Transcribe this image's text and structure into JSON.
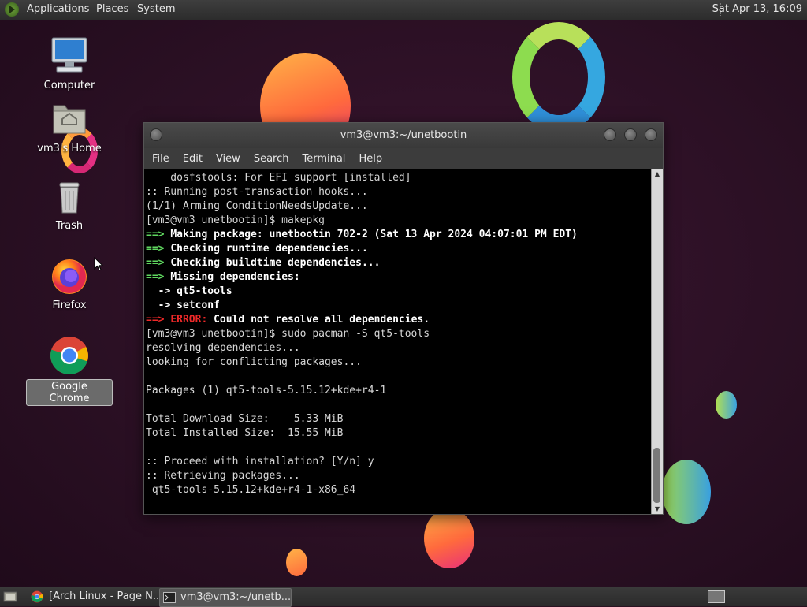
{
  "top_panel": {
    "menus": [
      "Applications",
      "Places",
      "System"
    ],
    "clock": "Sat Apr 13, 16:09"
  },
  "desktop_icons": [
    {
      "label": "Computer",
      "icon": "computer-icon"
    },
    {
      "label": "vm3's Home",
      "icon": "home-folder-icon"
    },
    {
      "label": "Trash",
      "icon": "trash-icon"
    },
    {
      "label": "Firefox",
      "icon": "firefox-icon"
    },
    {
      "label": "Google Chrome",
      "icon": "chrome-icon",
      "selected": true
    }
  ],
  "terminal": {
    "title": "vm3@vm3:~/unetbootin",
    "menu": [
      "File",
      "Edit",
      "View",
      "Search",
      "Terminal",
      "Help"
    ],
    "lines": [
      [
        {
          "t": "    dosfstools: For EFI support [installed]"
        }
      ],
      [
        {
          "t": ":: Running post-transaction hooks..."
        }
      ],
      [
        {
          "t": "(1/1) Arming ConditionNeedsUpdate..."
        }
      ],
      [
        {
          "t": "[vm3@vm3 unetbootin]$ makepkg"
        }
      ],
      [
        {
          "t": "==> ",
          "c": "g"
        },
        {
          "t": "Making package: unetbootin 702-2 (Sat 13 Apr 2024 04:07:01 PM EDT)",
          "c": "b"
        }
      ],
      [
        {
          "t": "==> ",
          "c": "g"
        },
        {
          "t": "Checking runtime dependencies...",
          "c": "b"
        }
      ],
      [
        {
          "t": "==> ",
          "c": "g"
        },
        {
          "t": "Checking buildtime dependencies...",
          "c": "b"
        }
      ],
      [
        {
          "t": "==> ",
          "c": "g"
        },
        {
          "t": "Missing dependencies:",
          "c": "b"
        }
      ],
      [
        {
          "t": "  -> ",
          "c": "b"
        },
        {
          "t": "qt5-tools",
          "c": "b"
        }
      ],
      [
        {
          "t": "  -> ",
          "c": "b"
        },
        {
          "t": "setconf",
          "c": "b"
        }
      ],
      [
        {
          "t": "==> ",
          "c": "r"
        },
        {
          "t": "ERROR: ",
          "c": "r"
        },
        {
          "t": "Could not resolve all dependencies.",
          "c": "b"
        }
      ],
      [
        {
          "t": "[vm3@vm3 unetbootin]$ sudo pacman -S qt5-tools"
        }
      ],
      [
        {
          "t": "resolving dependencies..."
        }
      ],
      [
        {
          "t": "looking for conflicting packages..."
        }
      ],
      [
        {
          "t": ""
        }
      ],
      [
        {
          "t": "Packages (1) qt5-tools-5.15.12+kde+r4-1"
        }
      ],
      [
        {
          "t": ""
        }
      ],
      [
        {
          "t": "Total Download Size:    5.33 MiB"
        }
      ],
      [
        {
          "t": "Total Installed Size:  15.55 MiB"
        }
      ],
      [
        {
          "t": ""
        }
      ],
      [
        {
          "t": ":: Proceed with installation? [Y/n] y"
        }
      ],
      [
        {
          "t": ":: Retrieving packages..."
        }
      ],
      [
        {
          "t": " qt5-tools-5.15.12+kde+r4-1-x86_64"
        }
      ]
    ]
  },
  "taskbar": {
    "tasks": [
      {
        "label": "[Arch Linux - Page N...",
        "icon": "chrome-icon",
        "active": false
      },
      {
        "label": "vm3@vm3:~/unetb...",
        "icon": "terminal-icon",
        "active": true
      }
    ]
  },
  "colors": {
    "prompt_green": "#5fd75f",
    "error_red": "#ef2929",
    "panel": "#333333",
    "desktop": "#2b1024"
  }
}
